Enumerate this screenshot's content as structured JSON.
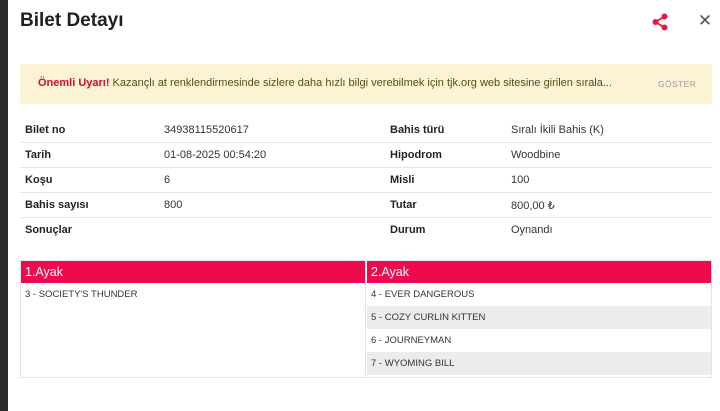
{
  "modal": {
    "title": "Bilet Detayı",
    "share_icon": "share-icon",
    "close_icon": "close-icon",
    "close_glyph": "✕"
  },
  "alert": {
    "strong": "Önemli Uyarı!",
    "message": "Kazançlı at renklendirmesinde sizlere daha hızlı bilgi verebilmek için tjk.org web sitesine girilen sırala...",
    "show_label": "GÖSTER"
  },
  "details": {
    "rows": [
      {
        "label1": "Bilet no",
        "value1": "34938115520617",
        "label2": "Bahis türü",
        "value2": "Sıralı İkili Bahis (K)"
      },
      {
        "label1": "Tarih",
        "value1": "01-08-2025 00:54:20",
        "label2": "Hipodrom",
        "value2": "Woodbine"
      },
      {
        "label1": "Koşu",
        "value1": "6",
        "label2": "Misli",
        "value2": "100"
      },
      {
        "label1": "Bahis sayısı",
        "value1": "800",
        "label2": "Tutar",
        "value2": "800,00 ₺"
      },
      {
        "label1": "Sonuçlar",
        "value1": "",
        "label2": "Durum",
        "value2": "Oynandı"
      }
    ]
  },
  "legs": [
    {
      "title": "1.Ayak",
      "horses": [
        "3 - SOCIETY'S THUNDER"
      ]
    },
    {
      "title": "2.Ayak",
      "horses": [
        "4 - EVER DANGEROUS",
        "5 - COZY CURLIN KITTEN",
        "6 - JOURNEYMAN",
        "7 - WYOMING BILL"
      ]
    }
  ],
  "colors": {
    "accent": "#ee0a4d",
    "alert_bg": "#fcf3d5",
    "warning_red": "#d10f2f"
  }
}
